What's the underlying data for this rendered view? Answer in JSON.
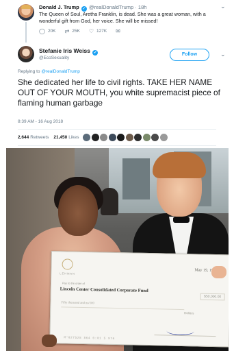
{
  "parent_tweet": {
    "author_name": "Donald J. Trump",
    "handle_time": "@realDonaldTrump · 18h",
    "text": "The Queen of Soul, Aretha Franklin, is dead. She was a great woman, with a wonderful gift from God, her voice. She will be missed!",
    "replies": "20K",
    "retweets": "25K",
    "likes": "127K",
    "icons": [
      "reply-icon",
      "retweet-icon",
      "like-icon",
      "dm-icon",
      "caret-icon",
      "verified-icon"
    ]
  },
  "tweet": {
    "author_name": "Stefanie Iris Weiss",
    "handle": "@EcoSexuality",
    "follow_label": "Follow",
    "replying_prefix": "Replying to",
    "replying_handle": "@realDonaldTrump",
    "text": "She dedicated her life to civil rights. TAKE HER NAME OUT OF YOUR MOUTH, you white supremacist piece of flaming human garbage",
    "timestamp": "8:39 AM - 16 Aug 2018",
    "retweets_count": "2,644",
    "retweets_label": "Retweets",
    "likes_count": "21,450",
    "likes_label": "Likes",
    "liker_colors": [
      "#5b6b7a",
      "#222222",
      "#8a8a8a",
      "#3d4a5a",
      "#1a1a1a",
      "#6c5a4a",
      "#2e2e2e",
      "#7a8a6a",
      "#4a4a4a",
      "#9a9a9a"
    ]
  },
  "photo": {
    "check": {
      "bank": "LEHMAN",
      "date": "May 19, 1997",
      "pay_to_label": "Pay to the order of",
      "payee": "Lincoln Center Consolidated Corporate Fund",
      "amount": "$50,000.00",
      "amount_words": "Fifty thousand and no/100",
      "dollars_label": "Dollars",
      "micr": "M°027528 864 0:01 5 976"
    }
  }
}
